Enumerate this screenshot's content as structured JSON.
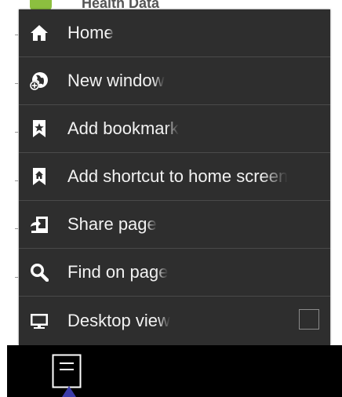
{
  "background": {
    "partial_title": "Health Data"
  },
  "menu": {
    "items": [
      {
        "label": "Home",
        "icon": "home-icon"
      },
      {
        "label": "New window",
        "icon": "globe-plus-icon"
      },
      {
        "label": "Add bookmark",
        "icon": "bookmark-star-icon"
      },
      {
        "label": "Add shortcut to home screen",
        "icon": "bookmark-home-icon"
      },
      {
        "label": "Share page",
        "icon": "share-icon"
      },
      {
        "label": "Find on page",
        "icon": "search-icon"
      },
      {
        "label": "Desktop view",
        "icon": "monitor-icon",
        "checkbox_checked": false
      }
    ]
  },
  "colors": {
    "menu_background": "#2e2e2e",
    "menu_divider": "#4a4a4a",
    "text": "#f2f2f2",
    "nav_bar": "#000000"
  }
}
